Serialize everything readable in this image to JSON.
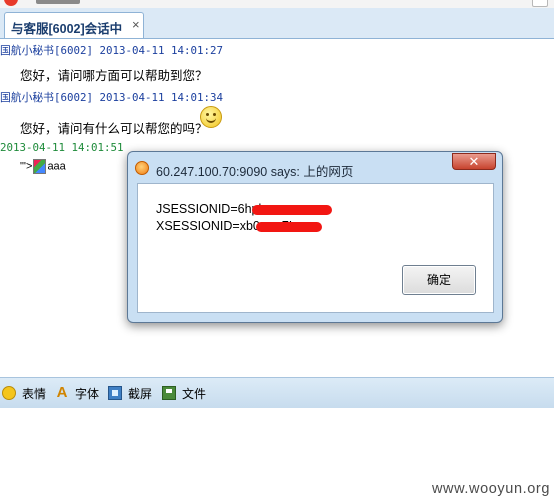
{
  "tab": {
    "label": "与客服[6002]会话中",
    "close_glyph": "×"
  },
  "messages": [
    {
      "sender": "国航小秘书[6002]",
      "time": "2013-04-11 14:01:27",
      "text": "您好，请问哪方面可以帮助到您？"
    },
    {
      "sender": "国航小秘书[6002]",
      "time": "2013-04-11 14:01:34",
      "text": "您好，请问有什么可以帮您的吗？",
      "emoticon": "smiley-icon"
    }
  ],
  "own_message": {
    "time": "2013-04-11 14:01:51",
    "prefix": "\"'>",
    "suffix": "aaa"
  },
  "toolbar": {
    "items": [
      {
        "label": "表情",
        "icon": "smiley-icon"
      },
      {
        "label": "字体",
        "icon": "font-icon"
      },
      {
        "label": "截屏",
        "icon": "screenshot-icon"
      },
      {
        "label": "文件",
        "icon": "file-icon"
      }
    ]
  },
  "dialog": {
    "title": "60.247.100.70:9090 says: 上的网页",
    "line1": "JSESSIONID=6hpk",
    "line2": "XSESSIONID=xb0",
    "line2_tail": "7L",
    "ok_label": "确定",
    "close_glyph": "✕",
    "redaction_color": "#f21612"
  },
  "watermark": "www.wooyun.org"
}
